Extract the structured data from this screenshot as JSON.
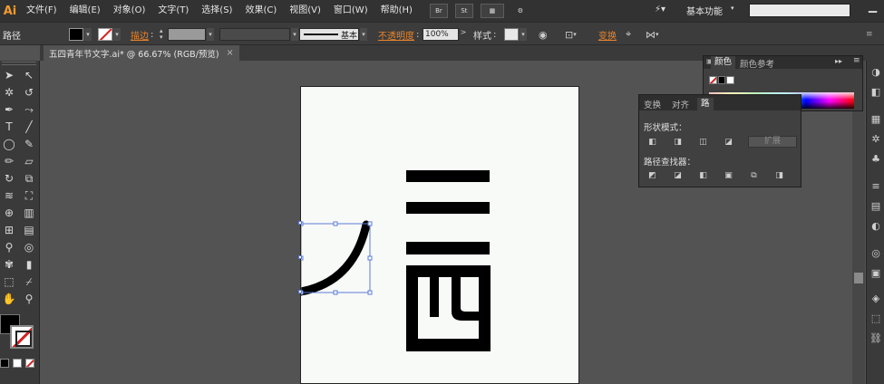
{
  "app": {
    "logo": "Ai"
  },
  "menu": [
    "文件(F)",
    "编辑(E)",
    "对象(O)",
    "文字(T)",
    "选择(S)",
    "效果(C)",
    "视图(V)",
    "窗口(W)",
    "帮助(H)"
  ],
  "menubar_buttons": [
    "Br",
    "St",
    "▦",
    "⚙"
  ],
  "workspace": {
    "label": "基本功能",
    "search_placeholder": ""
  },
  "control": {
    "label": "路径",
    "stroke_label": "描边",
    "brush_label": "基本",
    "opacity_label": "不透明度",
    "opacity_value": "100%",
    "style_label": "样式",
    "transform_label": "变换"
  },
  "document": {
    "tab_title": "五四青年节文字.ai* @ 66.67% (RGB/预览)",
    "close": "×"
  },
  "colors": {
    "accent": "#e9832a",
    "fill": "#000000",
    "stroke": "#ffffff",
    "artboard": "#f8faf8"
  },
  "color_panel": {
    "tabs": [
      "颜色",
      "颜色参考"
    ],
    "menu_icon": "≡"
  },
  "pathfinder_panel": {
    "tabs": [
      "变换",
      "对齐",
      "路"
    ],
    "shape_modes_label": "形状模式：",
    "pathfinders_label": "路径查找器：",
    "expand_label": "扩展"
  },
  "icons": {
    "toolbox": [
      "select-icon",
      "direct-select-icon",
      "magic-wand-icon",
      "lasso-icon",
      "pen-icon",
      "curvature-icon",
      "type-icon",
      "line-icon",
      "ellipse-icon",
      "brush-icon",
      "pencil-icon",
      "eraser-icon",
      "rotate-icon",
      "scale-icon",
      "warp-icon",
      "free-transform-icon",
      "shape-builder-icon",
      "perspective-icon",
      "mesh-icon",
      "gradient-icon",
      "eyedropper-icon",
      "blend-icon",
      "symbol-sprayer-icon",
      "graph-icon",
      "artboard-icon",
      "slice-icon",
      "hand-icon",
      "zoom-icon"
    ]
  }
}
